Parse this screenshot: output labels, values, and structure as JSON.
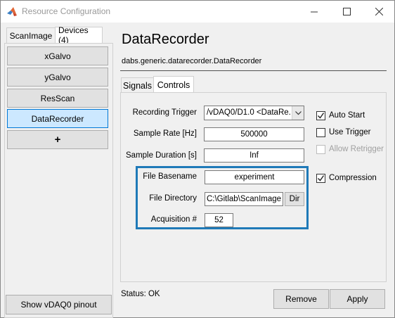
{
  "window": {
    "title": "Resource Configuration",
    "icons": {
      "app": "matlab-icon",
      "minimize": "minimize-icon",
      "maximize": "maximize-icon",
      "close": "close-icon"
    }
  },
  "left_tabs": [
    {
      "label": "ScanImage",
      "active": false
    },
    {
      "label": "Devices (4)",
      "active": true
    }
  ],
  "devices": [
    {
      "label": "xGalvo",
      "selected": false
    },
    {
      "label": "yGalvo",
      "selected": false
    },
    {
      "label": "ResScan",
      "selected": false
    },
    {
      "label": "DataRecorder",
      "selected": true
    },
    {
      "label": "+",
      "selected": false
    }
  ],
  "pinout_button": "Show vDAQ0 pinout",
  "device": {
    "title": "DataRecorder",
    "class_path": "dabs.generic.datarecorder.DataRecorder"
  },
  "content_tabs": [
    {
      "label": "Signals",
      "active": false
    },
    {
      "label": "Controls",
      "active": true
    }
  ],
  "controls": {
    "recording_trigger": {
      "label": "Recording Trigger",
      "value": "/vDAQ0/D1.0 <DataRe..."
    },
    "sample_rate": {
      "label": "Sample Rate [Hz]",
      "value": "500000"
    },
    "sample_duration": {
      "label": "Sample Duration [s]",
      "value": "Inf"
    },
    "file_basename": {
      "label": "File Basename",
      "value": "experiment"
    },
    "file_directory": {
      "label": "File Directory",
      "value": "C:\\Gitlab\\ScanImage"
    },
    "dir_button": "Dir",
    "acquisition_number": {
      "label": "Acquisition #",
      "value": "52"
    },
    "checkboxes": {
      "auto_start": {
        "label": "Auto Start",
        "checked": true,
        "enabled": true
      },
      "use_trigger": {
        "label": "Use Trigger",
        "checked": false,
        "enabled": true
      },
      "allow_retrigger": {
        "label": "Allow Retrigger",
        "checked": false,
        "enabled": false
      },
      "compression": {
        "label": "Compression",
        "checked": true,
        "enabled": true
      }
    }
  },
  "status": "Status: OK",
  "buttons": {
    "remove": "Remove",
    "apply": "Apply"
  },
  "colors": {
    "selection": "#cce8ff",
    "highlight_box": "#1f7ab8",
    "accent": "#0078d7"
  }
}
